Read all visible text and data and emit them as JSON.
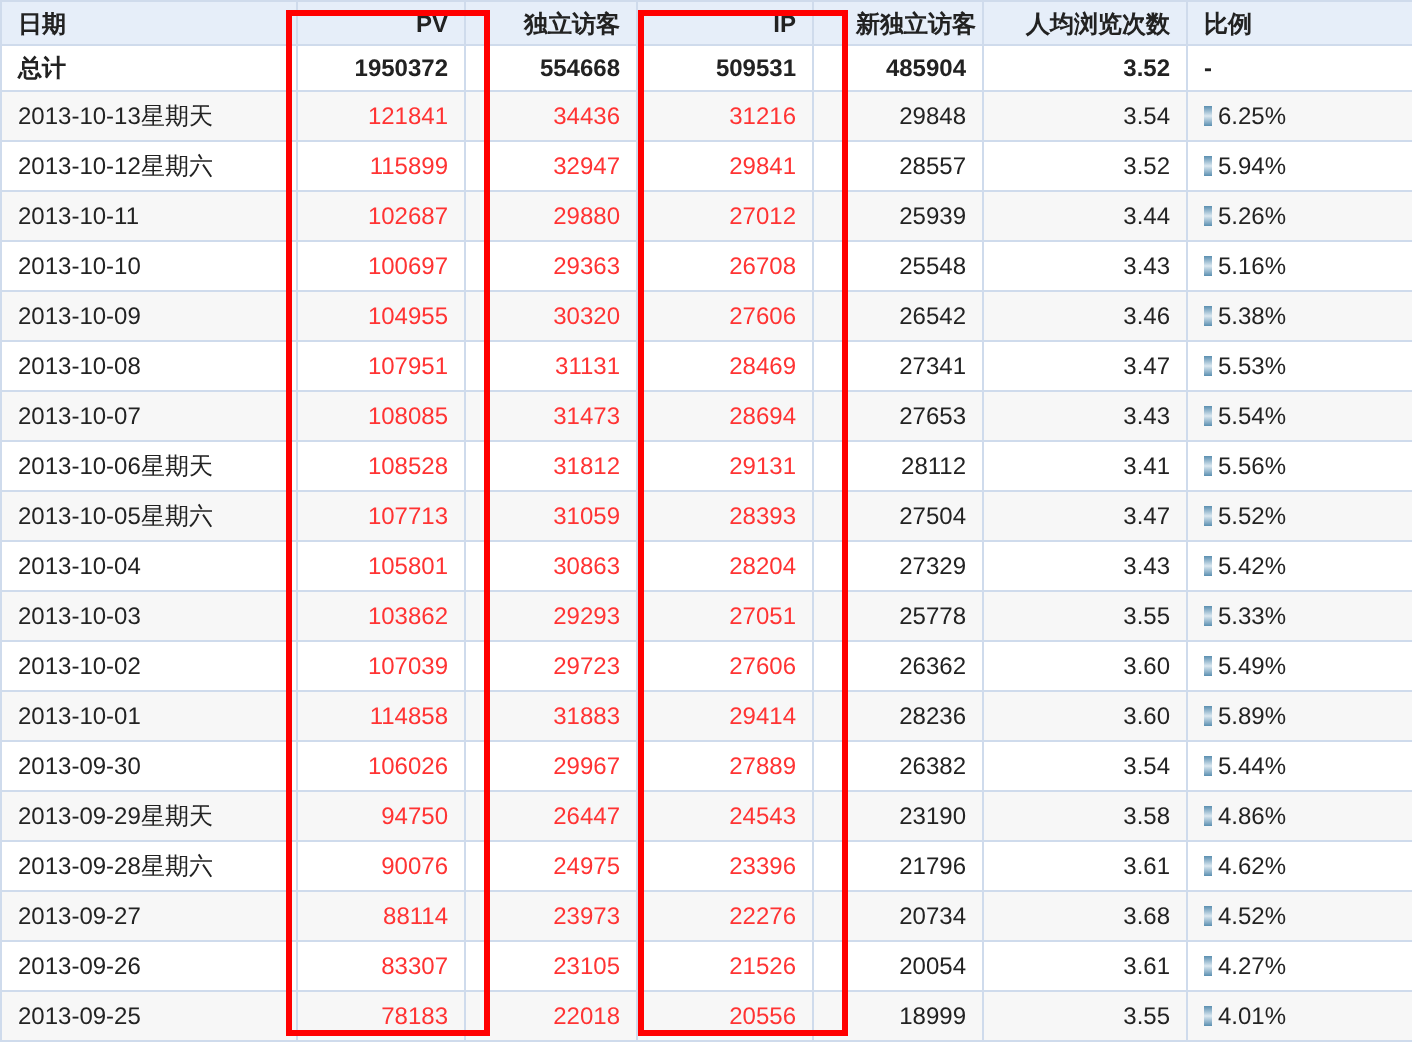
{
  "table": {
    "columns": [
      "日期",
      "PV",
      "独立访客",
      "IP",
      "新独立访客",
      "人均浏览次数",
      "比例"
    ],
    "total": {
      "date": "总计",
      "pv": "1950372",
      "uv": "554668",
      "ip": "509531",
      "new_uv": "485904",
      "avg": "3.52",
      "ratio": "-"
    },
    "rows": [
      {
        "date": "2013-10-13星期天",
        "pv": "121841",
        "uv": "34436",
        "ip": "31216",
        "new_uv": "29848",
        "avg": "3.54",
        "ratio": "6.25%"
      },
      {
        "date": "2013-10-12星期六",
        "pv": "115899",
        "uv": "32947",
        "ip": "29841",
        "new_uv": "28557",
        "avg": "3.52",
        "ratio": "5.94%"
      },
      {
        "date": "2013-10-11",
        "pv": "102687",
        "uv": "29880",
        "ip": "27012",
        "new_uv": "25939",
        "avg": "3.44",
        "ratio": "5.26%"
      },
      {
        "date": "2013-10-10",
        "pv": "100697",
        "uv": "29363",
        "ip": "26708",
        "new_uv": "25548",
        "avg": "3.43",
        "ratio": "5.16%"
      },
      {
        "date": "2013-10-09",
        "pv": "104955",
        "uv": "30320",
        "ip": "27606",
        "new_uv": "26542",
        "avg": "3.46",
        "ratio": "5.38%"
      },
      {
        "date": "2013-10-08",
        "pv": "107951",
        "uv": "31131",
        "ip": "28469",
        "new_uv": "27341",
        "avg": "3.47",
        "ratio": "5.53%"
      },
      {
        "date": "2013-10-07",
        "pv": "108085",
        "uv": "31473",
        "ip": "28694",
        "new_uv": "27653",
        "avg": "3.43",
        "ratio": "5.54%"
      },
      {
        "date": "2013-10-06星期天",
        "pv": "108528",
        "uv": "31812",
        "ip": "29131",
        "new_uv": "28112",
        "avg": "3.41",
        "ratio": "5.56%"
      },
      {
        "date": "2013-10-05星期六",
        "pv": "107713",
        "uv": "31059",
        "ip": "28393",
        "new_uv": "27504",
        "avg": "3.47",
        "ratio": "5.52%"
      },
      {
        "date": "2013-10-04",
        "pv": "105801",
        "uv": "30863",
        "ip": "28204",
        "new_uv": "27329",
        "avg": "3.43",
        "ratio": "5.42%"
      },
      {
        "date": "2013-10-03",
        "pv": "103862",
        "uv": "29293",
        "ip": "27051",
        "new_uv": "25778",
        "avg": "3.55",
        "ratio": "5.33%"
      },
      {
        "date": "2013-10-02",
        "pv": "107039",
        "uv": "29723",
        "ip": "27606",
        "new_uv": "26362",
        "avg": "3.60",
        "ratio": "5.49%"
      },
      {
        "date": "2013-10-01",
        "pv": "114858",
        "uv": "31883",
        "ip": "29414",
        "new_uv": "28236",
        "avg": "3.60",
        "ratio": "5.89%"
      },
      {
        "date": "2013-09-30",
        "pv": "106026",
        "uv": "29967",
        "ip": "27889",
        "new_uv": "26382",
        "avg": "3.54",
        "ratio": "5.44%"
      },
      {
        "date": "2013-09-29星期天",
        "pv": "94750",
        "uv": "26447",
        "ip": "24543",
        "new_uv": "23190",
        "avg": "3.58",
        "ratio": "4.86%"
      },
      {
        "date": "2013-09-28星期六",
        "pv": "90076",
        "uv": "24975",
        "ip": "23396",
        "new_uv": "21796",
        "avg": "3.61",
        "ratio": "4.62%"
      },
      {
        "date": "2013-09-27",
        "pv": "88114",
        "uv": "23973",
        "ip": "22276",
        "new_uv": "20734",
        "avg": "3.68",
        "ratio": "4.52%"
      },
      {
        "date": "2013-09-26",
        "pv": "83307",
        "uv": "23105",
        "ip": "21526",
        "new_uv": "20054",
        "avg": "3.61",
        "ratio": "4.27%"
      },
      {
        "date": "2013-09-25",
        "pv": "78183",
        "uv": "22018",
        "ip": "20556",
        "new_uv": "18999",
        "avg": "3.55",
        "ratio": "4.01%"
      }
    ]
  }
}
